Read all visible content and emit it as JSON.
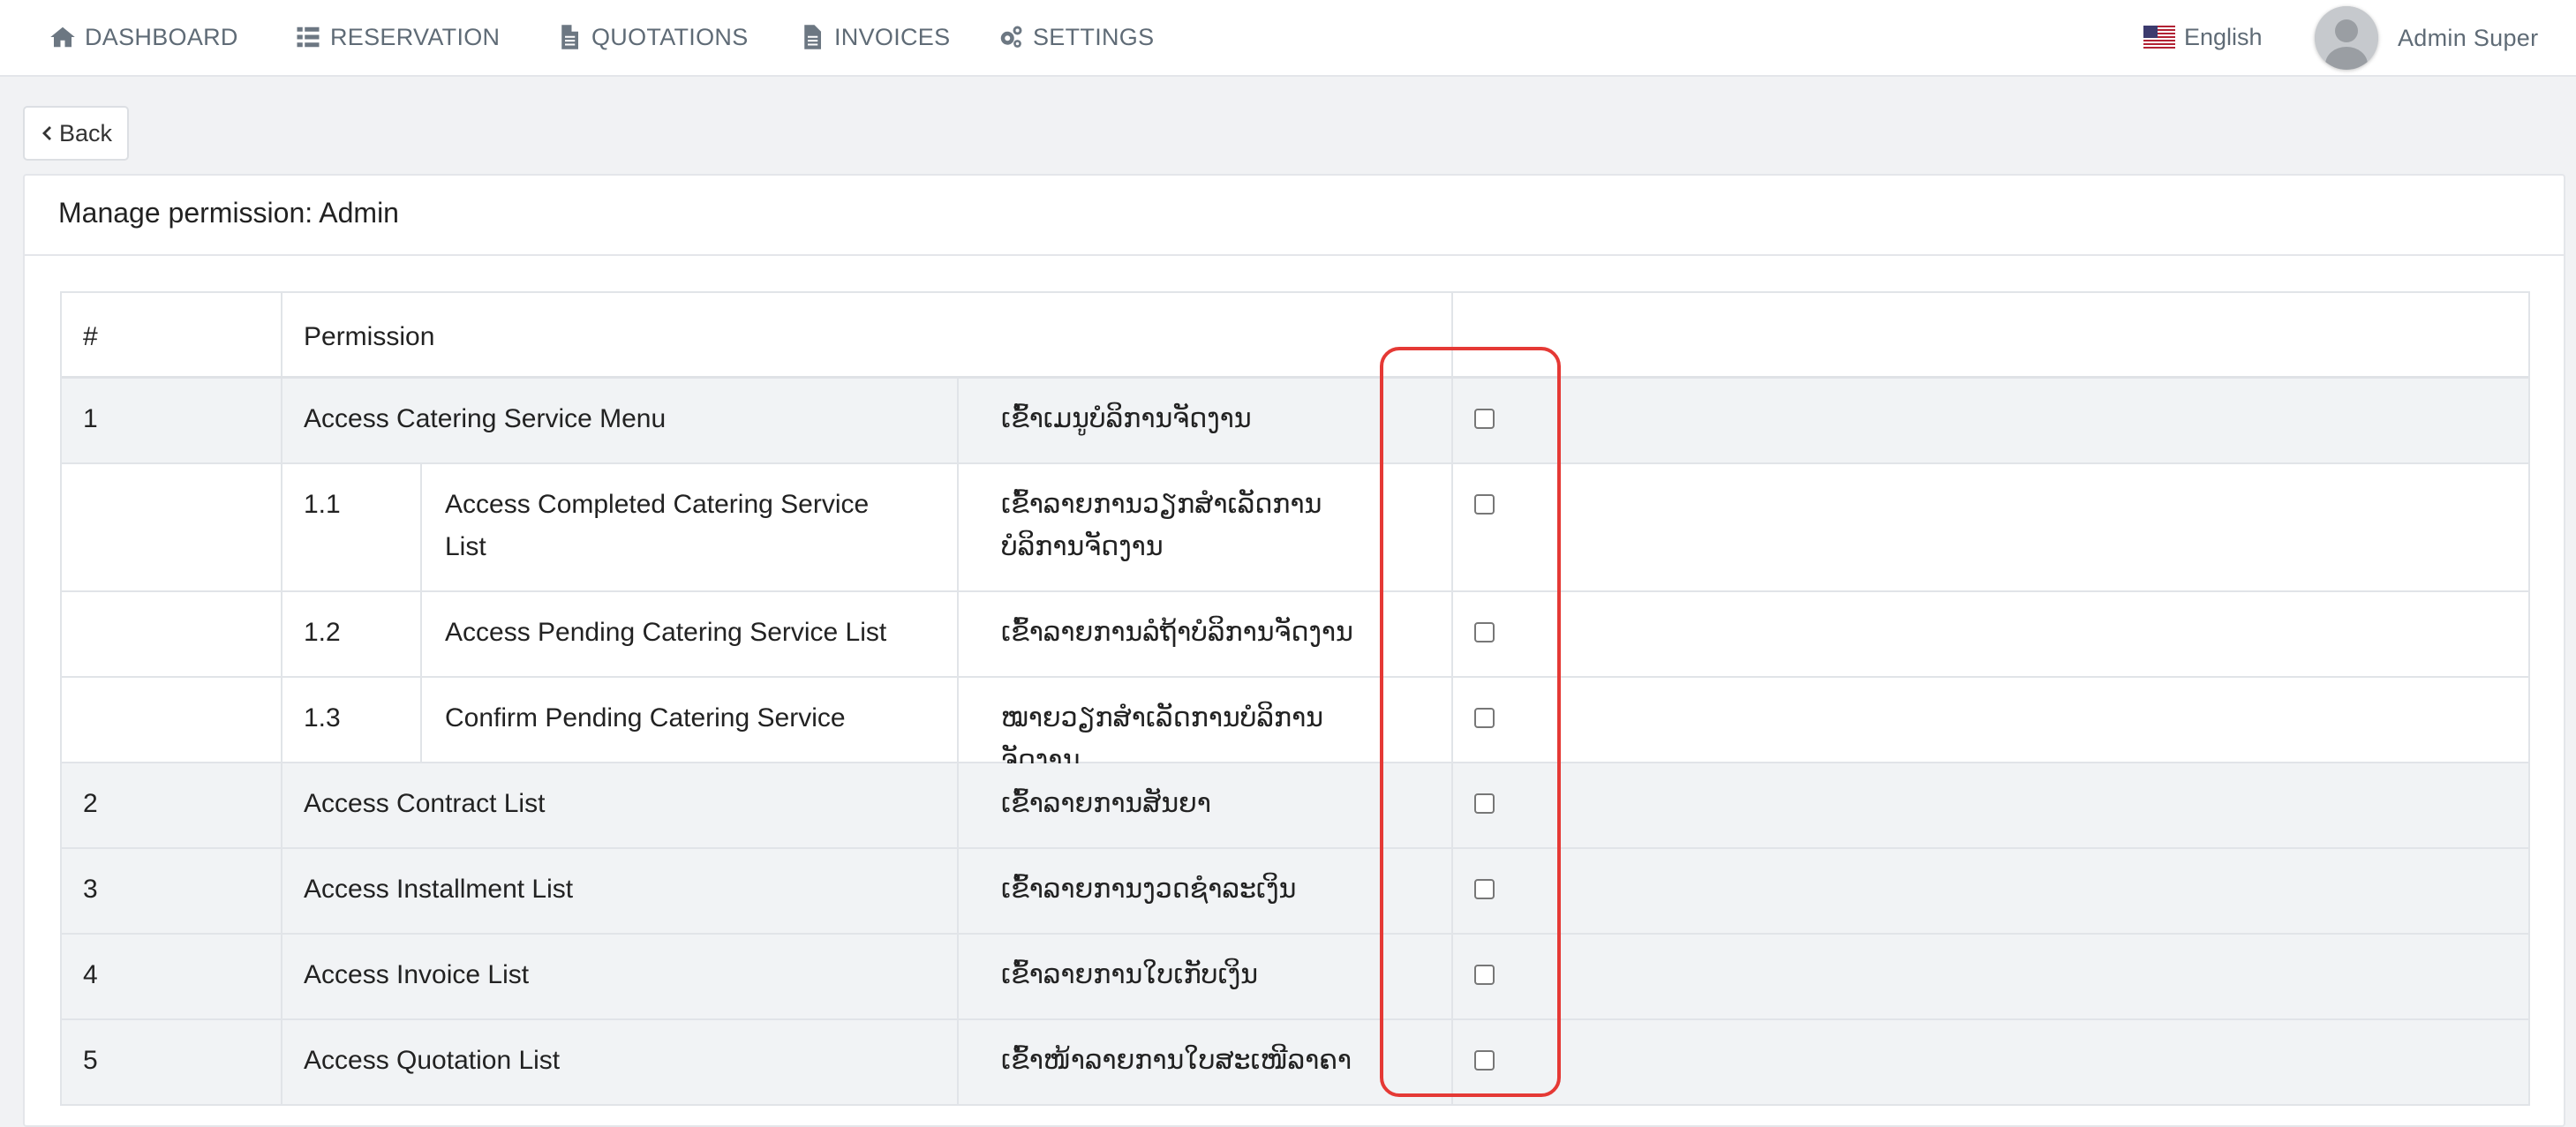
{
  "nav": {
    "dashboard": "DASHBOARD",
    "reservation": "RESERVATION",
    "quotations": "QUOTATIONS",
    "invoices": "INVOICES",
    "settings": "SETTINGS",
    "language": "English",
    "user_name": "Admin Super"
  },
  "back_label": "Back",
  "panel_title": "Manage permission: Admin",
  "table": {
    "head_num": "#",
    "head_permission": "Permission"
  },
  "rows": [
    {
      "num": "1",
      "label": "Access Catering Service Menu",
      "lao": "ເຂົ້າເມນູບໍລິການຈັດງານ",
      "checked": false
    },
    {
      "num": "1.1",
      "label": "Access Completed Catering Service List",
      "lao": "ເຂົ້າລາຍການວຽກສຳເລັດການບໍລິການຈັດງານ",
      "checked": false
    },
    {
      "num": "1.2",
      "label": "Access Pending Catering Service List",
      "lao": "ເຂົ້າລາຍການລໍຖ້າບໍລິການຈັດງານ",
      "checked": false
    },
    {
      "num": "1.3",
      "label": "Confirm Pending Catering Service",
      "lao": "ໝາຍວຽກສຳເລັດການບໍລິການຈັດງານ",
      "checked": false
    },
    {
      "num": "2",
      "label": "Access Contract List",
      "lao": "ເຂົ້າລາຍການສັນຍາ",
      "checked": false
    },
    {
      "num": "3",
      "label": "Access Installment List",
      "lao": "ເຂົ້າລາຍການງວດຊຳລະເງິນ",
      "checked": false
    },
    {
      "num": "4",
      "label": "Access Invoice List",
      "lao": "ເຂົ້າລາຍການໃບເກັບເງິນ",
      "checked": false
    },
    {
      "num": "5",
      "label": "Access Quotation List",
      "lao": "ເຂົ້າໜ້າລາຍການໃບສະເໜີລາຄາ",
      "checked": false
    }
  ],
  "colors": {
    "highlight": "#e53935",
    "row_alt": "#f1f3f5",
    "nav_text": "#5f6b76"
  }
}
